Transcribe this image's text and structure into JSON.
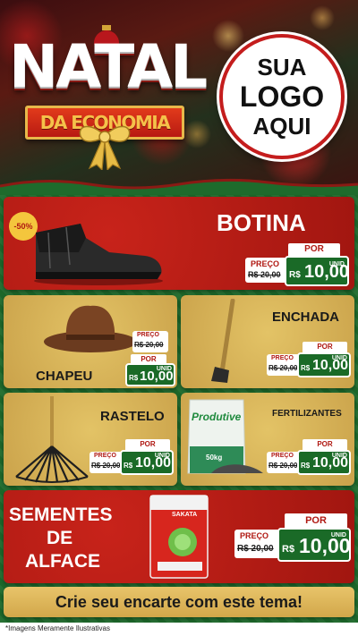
{
  "header": {
    "title": "NATAL",
    "subtitle": "DA ECONOMIA",
    "logo_lines": [
      "SUA",
      "LOGO",
      "AQUI"
    ]
  },
  "products": [
    {
      "name": "BOTINA",
      "badge": "-50%",
      "price_label": "PREÇO",
      "old_price": "R$ 20,00",
      "por_label": "POR",
      "currency": "R$",
      "new_price": "10,00",
      "unit": "UNID"
    },
    {
      "name": "CHAPEU",
      "price_label": "PREÇO",
      "old_price": "R$ 20,00",
      "por_label": "POR",
      "currency": "R$",
      "new_price": "10,00",
      "unit": "UNID"
    },
    {
      "name": "ENCHADA",
      "price_label": "PREÇO",
      "old_price": "R$ 20,00",
      "por_label": "POR",
      "currency": "R$",
      "new_price": "10,00",
      "unit": "UNID"
    },
    {
      "name": "RASTELO",
      "price_label": "PREÇO",
      "old_price": "R$ 20,00",
      "por_label": "POR",
      "currency": "R$",
      "new_price": "10,00",
      "unit": "UNID"
    },
    {
      "name": "FERTILIZANTES",
      "bag_brand": "Produtive",
      "bag_weight": "50kg",
      "price_label": "PREÇO",
      "old_price": "R$ 20,00",
      "por_label": "POR",
      "currency": "R$",
      "new_price": "10,00",
      "unit": "UNID"
    },
    {
      "name_lines": [
        "SEMENTES",
        "DE",
        "ALFACE"
      ],
      "packet_brand": "SAKATA",
      "price_label": "PREÇO",
      "old_price": "R$ 20,00",
      "por_label": "POR",
      "currency": "R$",
      "new_price": "10,00",
      "unit": "UNID"
    }
  ],
  "cta": "Crie seu encarte com este tema!",
  "footnote": "*Imagens Meramente Ilustrativas",
  "colors": {
    "red": "#b01812",
    "green": "#1a6a27",
    "gold": "#d6b055",
    "board_green": "#1e6b2c"
  }
}
